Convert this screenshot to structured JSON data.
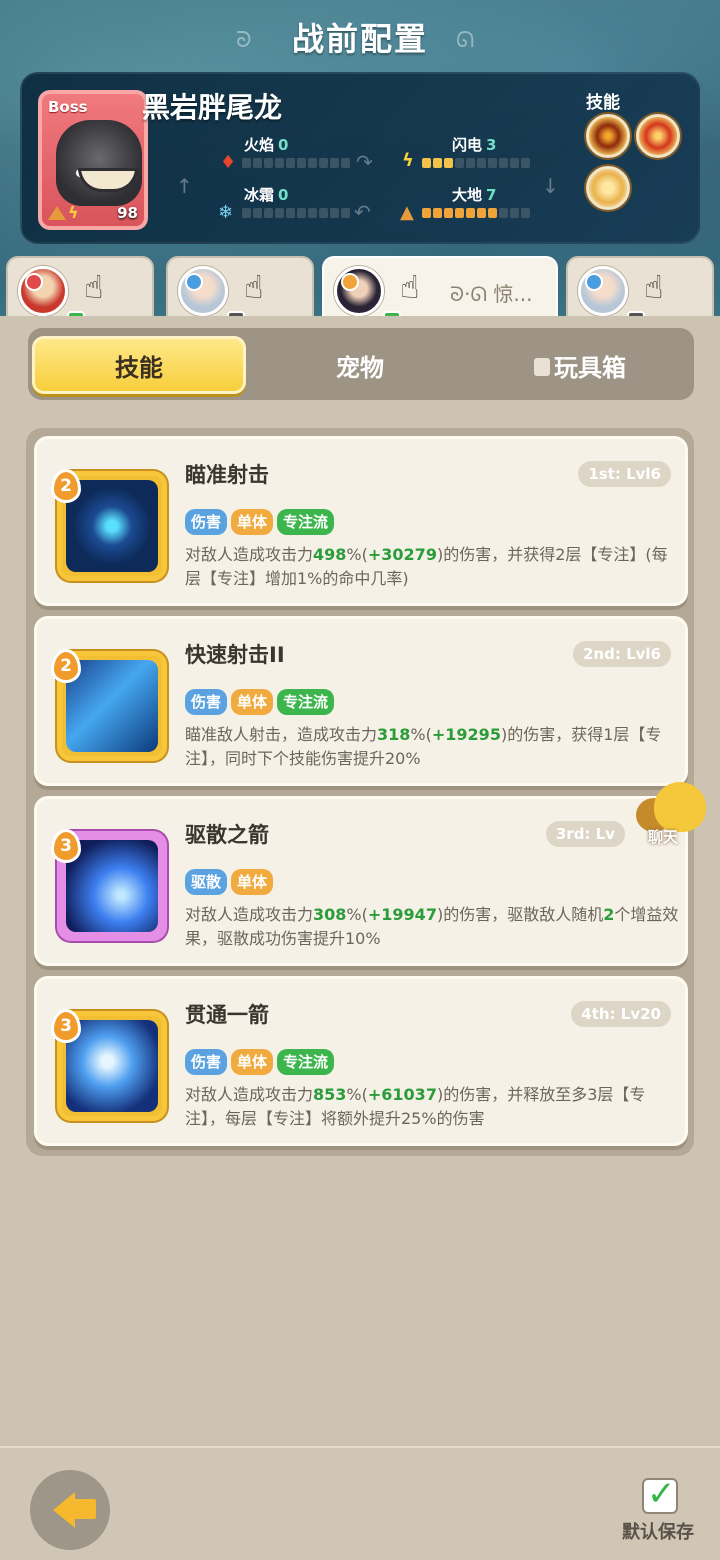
{
  "header": {
    "title": "战前配置"
  },
  "boss": {
    "tag": "Boss",
    "name": "黑岩胖尾龙",
    "level": "98",
    "stats": [
      {
        "label": "火焰",
        "value": "0",
        "filled": 0
      },
      {
        "label": "闪电",
        "value": "3",
        "filled": 3
      },
      {
        "label": "冰霜",
        "value": "0",
        "filled": 0
      },
      {
        "label": "大地",
        "value": "7",
        "filled": 7
      }
    ],
    "skills_label": "技能",
    "skills": [
      "fire-claw-icon",
      "fire-orb-icon",
      "lion-shield-icon"
    ]
  },
  "heroes": [
    {
      "name": "hero-1",
      "icon": "pointing-hand-icon"
    },
    {
      "name": "hero-2",
      "icon": "pointing-hand-icon"
    },
    {
      "name": "hero-3",
      "icon": "pointing-hand-icon",
      "text": "惊...",
      "active": true
    },
    {
      "name": "hero-4",
      "icon": "pointing-hand-icon"
    }
  ],
  "tabs": {
    "skills": "技能",
    "pets": "宠物",
    "toybox": "玩具箱"
  },
  "cards": [
    {
      "title": "瞄准射击",
      "rank": "1st: Lvl6",
      "level": "2",
      "tags": [
        "伤害",
        "单体",
        "专注流"
      ],
      "d1": "对敌人造成攻击力",
      "v1": "498",
      "d2": "%(",
      "v2": "+30279",
      "d3": ")的伤害，并获得2层【专注】(每层【专注】增加1%的命中几率)"
    },
    {
      "title": "快速射击II",
      "rank": "2nd: Lvl6",
      "level": "2",
      "tags": [
        "伤害",
        "单体",
        "专注流"
      ],
      "d1": "瞄准敌人射击，造成攻击力",
      "v1": "318",
      "d2": "%(",
      "v2": "+19295",
      "d3": ")的伤害，获得1层【专注】，同时下个技能伤害提升20%"
    },
    {
      "title": "驱散之箭",
      "rank": "3rd: Lv",
      "level": "3",
      "tags": [
        "驱散",
        "单体"
      ],
      "d1": "对敌人造成攻击力",
      "v1": "308",
      "d2": "%(",
      "v2": "+19947",
      "d3": ")的伤害，驱散敌人随机",
      "v3": "2",
      "d4": "个增益效果，驱散成功伤害提升10%"
    },
    {
      "title": "贯通一箭",
      "rank": "4th: Lv20",
      "level": "3",
      "tags": [
        "伤害",
        "单体",
        "专注流"
      ],
      "d1": "对敌人造成攻击力",
      "v1": "853",
      "d2": "%(",
      "v2": "+61037",
      "d3": ")的伤害，并释放至多3层【专注】，每层【专注】将额外提升25%的伤害"
    }
  ],
  "chat": {
    "label": "聊天"
  },
  "footer": {
    "save_label": "默认保存"
  }
}
